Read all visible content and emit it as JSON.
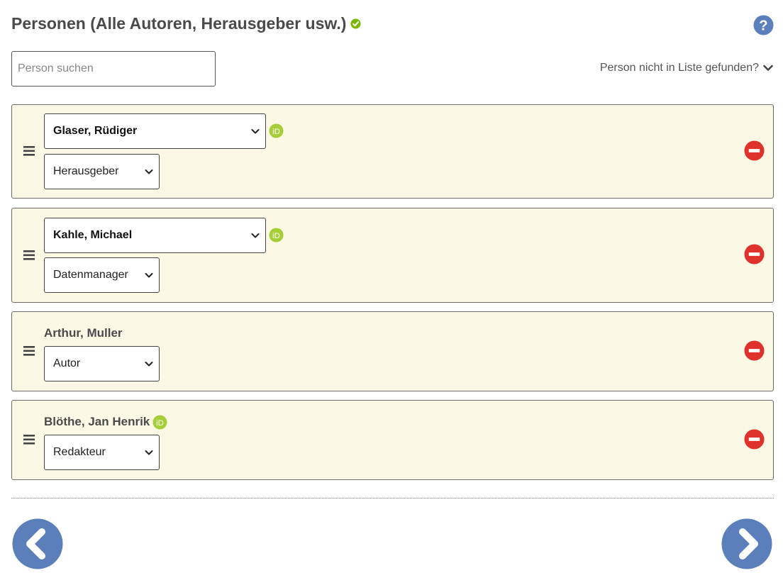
{
  "header": {
    "title": "Personen (Alle Autoren, Herausgeber usw.)",
    "check_icon": "check-circle-icon",
    "help_icon": "question-circle-icon"
  },
  "search": {
    "placeholder": "Person suchen",
    "value": ""
  },
  "not_found": {
    "label": "Person nicht in Liste gefunden?",
    "icon": "chevron-down-icon"
  },
  "persons": [
    {
      "name": "Glaser, Rüdiger",
      "editable": true,
      "orcid": true,
      "role": "Herausgeber"
    },
    {
      "name": "Kahle, Michael",
      "editable": true,
      "orcid": true,
      "role": "Datenmanager"
    },
    {
      "name": "Arthur, Muller",
      "editable": false,
      "orcid": false,
      "role": "Autor"
    },
    {
      "name": "Blöthe, Jan Henrik",
      "editable": false,
      "orcid": true,
      "role": "Redakteur"
    }
  ],
  "navigation": {
    "back_icon": "chevron-left-icon",
    "next_icon": "chevron-right-icon"
  },
  "colors": {
    "accent_blue": "#5b7fba",
    "remove_red": "#e0322c",
    "orcid_green": "#a6ce39",
    "card_background": "#fcf8e6",
    "check_green": "#7ab800"
  }
}
